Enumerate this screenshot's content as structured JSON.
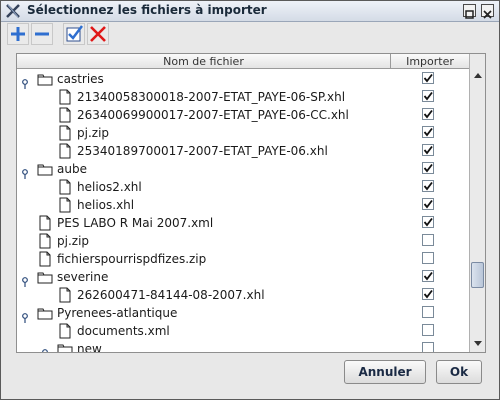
{
  "window": {
    "title": "Sélectionnez les fichiers à importer"
  },
  "toolbar": {
    "buttons": [
      {
        "icon": "plus-icon"
      },
      {
        "icon": "minus-icon"
      },
      {
        "icon": "checkmark-icon"
      },
      {
        "icon": "cross-icon"
      }
    ]
  },
  "columns": {
    "name": "Nom de fichier",
    "import": "Importer"
  },
  "tree": [
    {
      "label": "castries",
      "type": "folder",
      "depth": 0,
      "expanded": true,
      "checked": true
    },
    {
      "label": "21340058300018-2007-ETAT_PAYE-06-SP.xhl",
      "type": "file",
      "depth": 1,
      "checked": true
    },
    {
      "label": "26340069900017-2007-ETAT_PAYE-06-CC.xhl",
      "type": "file",
      "depth": 1,
      "checked": true
    },
    {
      "label": "pj.zip",
      "type": "file",
      "depth": 1,
      "checked": true
    },
    {
      "label": "25340189700017-2007-ETAT_PAYE-06.xhl",
      "type": "file",
      "depth": 1,
      "checked": true
    },
    {
      "label": "aube",
      "type": "folder",
      "depth": 0,
      "expanded": true,
      "checked": true
    },
    {
      "label": "helios2.xhl",
      "type": "file",
      "depth": 1,
      "checked": true
    },
    {
      "label": "helios.xhl",
      "type": "file",
      "depth": 1,
      "checked": true
    },
    {
      "label": "PES LABO R Mai 2007.xml",
      "type": "file",
      "depth": 0,
      "checked": true
    },
    {
      "label": "pj.zip",
      "type": "file",
      "depth": 0,
      "checked": false
    },
    {
      "label": "fichierspourrispdfizes.zip",
      "type": "file",
      "depth": 0,
      "checked": false
    },
    {
      "label": "severine",
      "type": "folder",
      "depth": 0,
      "expanded": true,
      "checked": true
    },
    {
      "label": "262600471-84144-08-2007.xhl",
      "type": "file",
      "depth": 1,
      "checked": true
    },
    {
      "label": "Pyrenees-atlantique",
      "type": "folder",
      "depth": 0,
      "expanded": true,
      "checked": false
    },
    {
      "label": "documents.xml",
      "type": "file",
      "depth": 1,
      "checked": false
    },
    {
      "label": "new",
      "type": "folder",
      "depth": 1,
      "expanded": false,
      "checked": false
    }
  ],
  "buttons": {
    "cancel": "Annuler",
    "ok": "Ok"
  }
}
